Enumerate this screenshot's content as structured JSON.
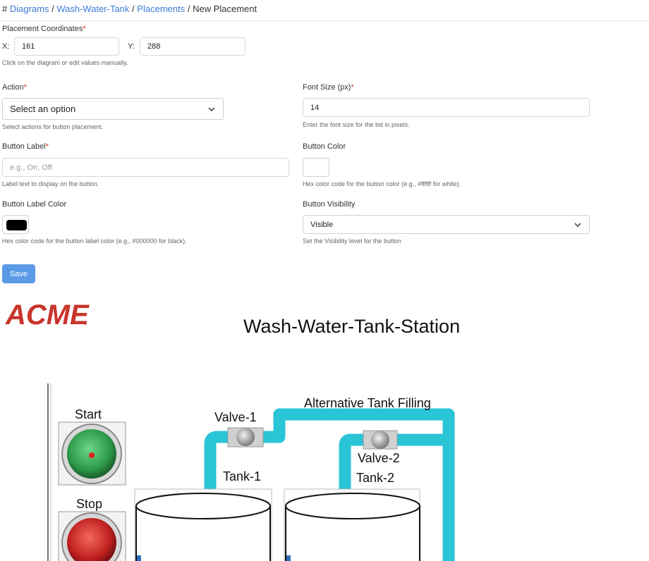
{
  "breadcrumb": {
    "hash": "#",
    "items": [
      "Diagrams",
      "Wash-Water-Tank",
      "Placements"
    ],
    "current": "New Placement",
    "separator": "/"
  },
  "form": {
    "coordinates": {
      "label": "Placement Coordinates",
      "x_label": "X:",
      "x_value": "161",
      "y_label": "Y:",
      "y_value": "288",
      "help": "Click on the diagram or edit values manually."
    },
    "action": {
      "label": "Action",
      "value": "Select an option",
      "help": "Select actions for button placement."
    },
    "font_size": {
      "label": "Font Size (px)",
      "value": "14",
      "help": "Enter the font size for the list in pixels."
    },
    "button_label": {
      "label": "Button Label",
      "placeholder": "e.g., On, Off",
      "help": "Label text to display on the button."
    },
    "button_color": {
      "label": "Button Color",
      "value_color": "#ffffff",
      "help": "Hex color code for the button color (e.g., #ffffff for white)."
    },
    "button_label_color": {
      "label": "Button Label Color",
      "value_color": "#000000",
      "help": "Hex color code for the button label color (e.g., #000000 for black)."
    },
    "visibility": {
      "label": "Button Visibility",
      "value": "Visible",
      "help": "Set the Visibility level for the button"
    },
    "required_mark": "*",
    "save_label": "Save"
  },
  "diagram": {
    "logo_text": "ACME",
    "title": "Wash-Water-Tank-Station",
    "pipe_label": "Alternative Tank Filling",
    "start_label": "Start",
    "stop_label": "Stop",
    "valve1_label": "Valve-1",
    "valve2_label": "Valve-2",
    "tank1_label": "Tank-1",
    "tank2_label": "Tank-2"
  },
  "colors": {
    "link": "#3a7bd5",
    "required": "#d93025",
    "save_button": "#5b9be6",
    "pipe": "#29c4d6",
    "logo": "#c8352b",
    "start_button": "#2c9a4a",
    "stop_button": "#c0201f"
  }
}
